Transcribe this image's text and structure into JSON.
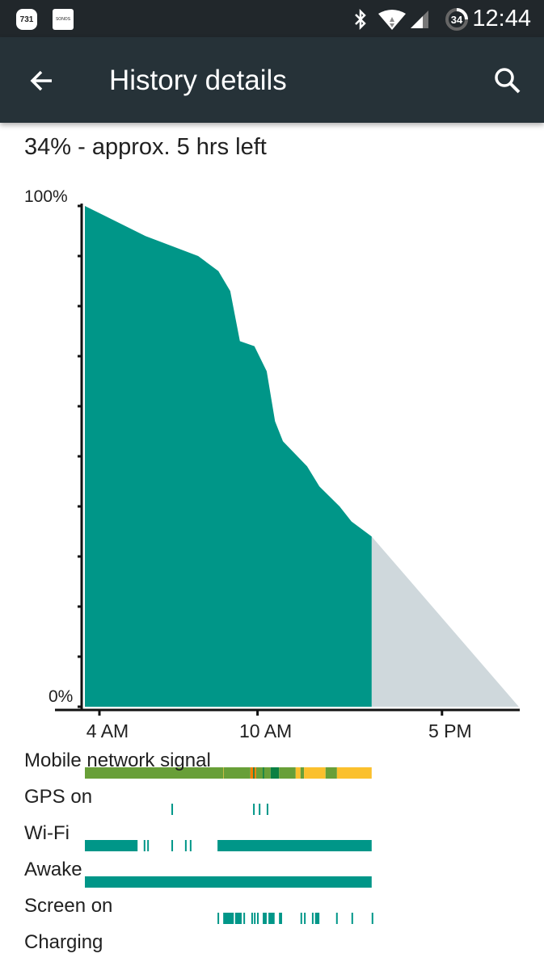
{
  "status_bar": {
    "notifications": [
      {
        "icon": "badge-icon",
        "text": "731"
      },
      {
        "icon": "sonos-icon",
        "text": "SONOS"
      }
    ],
    "icons": [
      "bluetooth-icon",
      "wifi-icon",
      "cell-signal-icon",
      "battery-circle-icon"
    ],
    "battery_level": "34",
    "time": "12:44"
  },
  "toolbar": {
    "title": "History details",
    "back_icon": "arrow-back-icon",
    "search_icon": "search-icon"
  },
  "summary": "34% - approx. 5 hrs left",
  "colors": {
    "battery": "#009688",
    "prediction": "#cfd8dc",
    "good": "#689f38",
    "great": "#0b8043",
    "moderate": "#fbc02d",
    "poor": "#f57c00",
    "bar": "#009688"
  },
  "chart_data": {
    "type": "area",
    "y_labels": {
      "top": "100%",
      "bottom": "0%"
    },
    "ylim": [
      0,
      100
    ],
    "y_ticks_every": 10,
    "x_range": [
      "03:27",
      "20:00"
    ],
    "x_ticks": [
      {
        "time": "04:00",
        "label": "4 AM"
      },
      {
        "time": "10:00",
        "label": "10 AM"
      },
      {
        "time": "17:00",
        "label": "5 PM"
      }
    ],
    "battery_history": [
      [
        "03:27",
        100
      ],
      [
        "05:45",
        94
      ],
      [
        "07:45",
        90
      ],
      [
        "08:31",
        87
      ],
      [
        "08:58",
        83
      ],
      [
        "09:20",
        73
      ],
      [
        "09:53",
        72
      ],
      [
        "10:21",
        67
      ],
      [
        "10:40",
        57
      ],
      [
        "10:58",
        53
      ],
      [
        "11:53",
        48
      ],
      [
        "12:21",
        44
      ],
      [
        "13:07",
        40
      ],
      [
        "13:34",
        37
      ],
      [
        "14:20",
        34
      ]
    ],
    "prediction": [
      [
        "14:20",
        34
      ],
      [
        "19:55",
        0
      ]
    ]
  },
  "timeline": {
    "rows": [
      {
        "label": "Mobile network signal",
        "segments": [
          [
            "03:27",
            "08:42",
            "good"
          ],
          [
            "08:42",
            "08:43",
            "moderate"
          ],
          [
            "08:43",
            "09:44",
            "good"
          ],
          [
            "09:44",
            "09:50",
            "poor"
          ],
          [
            "09:50",
            "09:53",
            "great"
          ],
          [
            "09:53",
            "09:57",
            "poor"
          ],
          [
            "09:57",
            "10:12",
            "good"
          ],
          [
            "10:12",
            "10:15",
            "great"
          ],
          [
            "10:15",
            "10:30",
            "good"
          ],
          [
            "10:30",
            "10:49",
            "great"
          ],
          [
            "10:49",
            "11:27",
            "good"
          ],
          [
            "11:27",
            "11:38",
            "moderate"
          ],
          [
            "11:38",
            "11:46",
            "good"
          ],
          [
            "11:46",
            "12:35",
            "moderate"
          ],
          [
            "12:35",
            "13:01",
            "good"
          ],
          [
            "13:01",
            "14:20",
            "moderate"
          ]
        ]
      },
      {
        "label": "GPS on",
        "segments": [
          [
            "06:44",
            "06:44"
          ],
          [
            "09:50",
            "09:50"
          ],
          [
            "10:03",
            "10:06"
          ],
          [
            "10:21",
            "10:21"
          ]
        ]
      },
      {
        "label": "Wi-Fi",
        "segments": [
          [
            "03:27",
            "05:27"
          ],
          [
            "05:41",
            "05:41"
          ],
          [
            "05:49",
            "05:49"
          ],
          [
            "06:44",
            "06:44"
          ],
          [
            "07:15",
            "07:15"
          ],
          [
            "07:26",
            "07:26"
          ],
          [
            "08:29",
            "14:20"
          ]
        ]
      },
      {
        "label": "Awake",
        "segments": [
          [
            "03:27",
            "14:20"
          ]
        ]
      },
      {
        "label": "Screen on",
        "segments": [
          [
            "08:29",
            "08:29"
          ],
          [
            "08:42",
            "09:06"
          ],
          [
            "09:09",
            "09:24"
          ],
          [
            "09:28",
            "09:31"
          ],
          [
            "09:46",
            "09:46"
          ],
          [
            "09:52",
            "09:52"
          ],
          [
            "09:59",
            "09:59"
          ],
          [
            "10:12",
            "10:21"
          ],
          [
            "10:25",
            "10:39"
          ],
          [
            "10:49",
            "10:56"
          ],
          [
            "11:38",
            "11:38"
          ],
          [
            "11:46",
            "11:46"
          ],
          [
            "12:04",
            "12:04"
          ],
          [
            "12:11",
            "12:21"
          ],
          [
            "12:59",
            "12:59"
          ],
          [
            "13:34",
            "13:34"
          ],
          [
            "14:20",
            "14:20"
          ]
        ]
      },
      {
        "label": "Charging",
        "segments": []
      }
    ]
  }
}
